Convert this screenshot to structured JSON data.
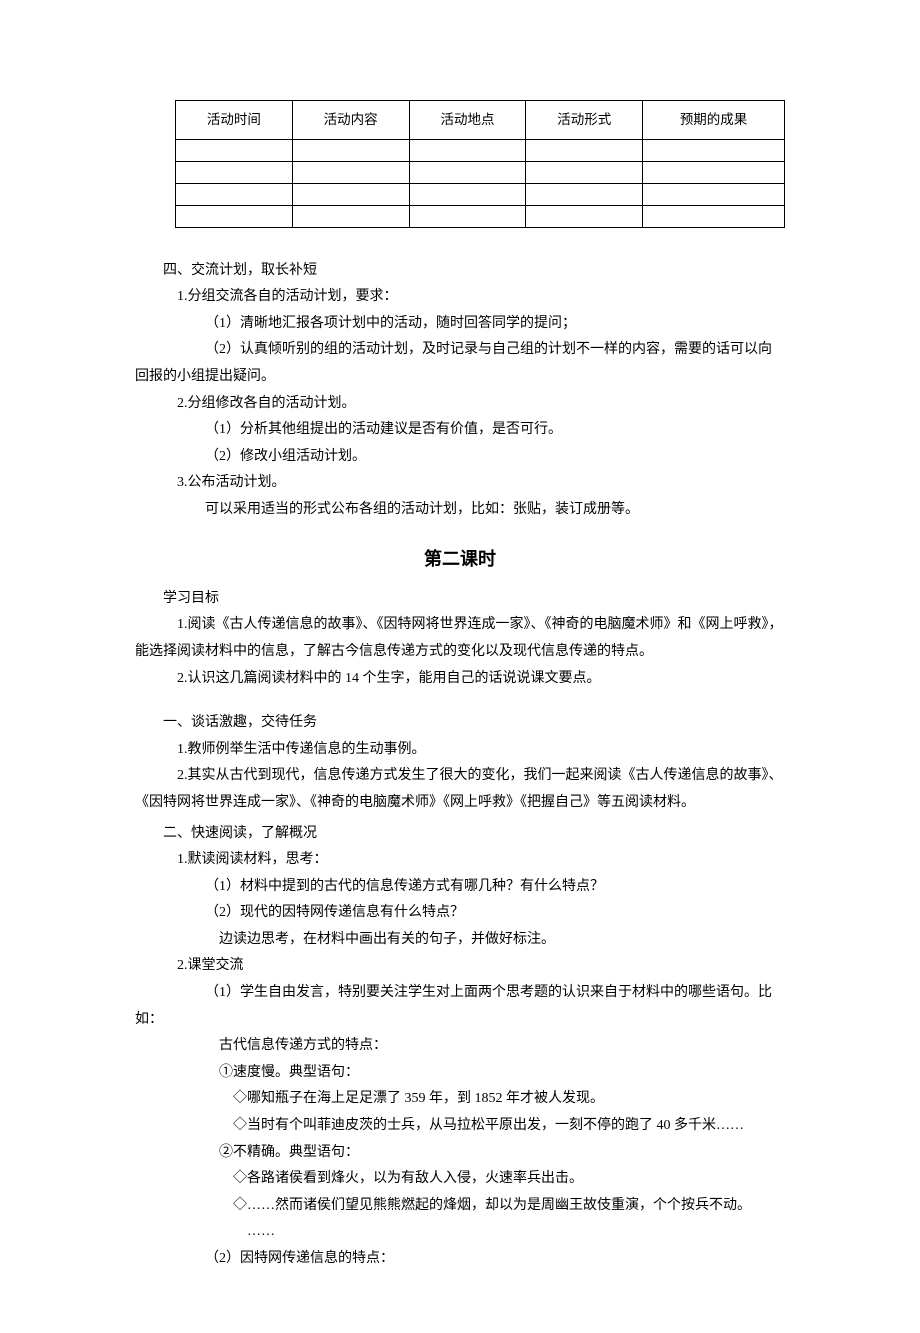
{
  "table": {
    "headers": [
      "活动时间",
      "活动内容",
      "活动地点",
      "活动形式",
      "预期的成果"
    ]
  },
  "sec4": {
    "title": "四、交流计划，取长补短",
    "p1": "1.分组交流各自的活动计划，要求：",
    "p1a": "（1）清晰地汇报各项计划中的活动，随时回答同学的提问；",
    "p1b": "（2）认真倾听别的组的活动计划，及时记录与自己组的计划不一样的内容，需要的话可以向回报的小组提出疑问。",
    "p2": "2.分组修改各自的活动计划。",
    "p2a": "（1）分析其他组提出的活动建议是否有价值，是否可行。",
    "p2b": "（2）修改小组活动计划。",
    "p3": "3.公布活动计划。",
    "p3a": "可以采用适当的形式公布各组的活动计划，比如：张贴，装订成册等。"
  },
  "lesson2": {
    "title": "第二课时",
    "goals_label": "学习目标",
    "g1": "1.阅读《古人传递信息的故事》、《因特网将世界连成一家》、《神奇的电脑魔术师》和《网上呼救》，能选择阅读材料中的信息，了解古今信息传递方式的变化以及现代信息传递的特点。",
    "g2": "2.认识这几篇阅读材料中的 14 个生字，能用自己的话说说课文要点。",
    "s1_title": "一、谈话激趣，交待任务",
    "s1_p1": "1.教师例举生活中传递信息的生动事例。",
    "s1_p2": "2.其实从古代到现代，信息传递方式发生了很大的变化，我们一起来阅读《古人传递信息的故事》、《因特网将世界连成一家》、《神奇的电脑魔术师》《网上呼救》《把握自己》等五阅读材料。",
    "s2_title": "二、快速阅读，了解概况",
    "s2_p1": "1.默读阅读材料，思考：",
    "s2_p1a": "（1）材料中提到的古代的信息传递方式有哪几种？有什么特点？",
    "s2_p1b": "（2）现代的因特网传递信息有什么特点？",
    "s2_p1c": "边读边思考，在材料中画出有关的句子，并做好标注。",
    "s2_p2": "2.课堂交流",
    "s2_p2a": "（1）学生自由发言，特别要关注学生对上面两个思考题的认识来自于材料中的哪些语句。比如：",
    "s2_p2a_sub": "古代信息传递方式的特点：",
    "s2_p2a_i": "①速度慢。典型语句：",
    "s2_p2a_i_a": "◇哪知瓶子在海上足足漂了 359 年，到 1852 年才被人发现。",
    "s2_p2a_i_b": "◇当时有个叫菲迪皮茨的士兵，从马拉松平原出发，一刻不停的跑了 40 多千米……",
    "s2_p2a_ii": "②不精确。典型语句：",
    "s2_p2a_ii_a": "◇各路诸侯看到烽火，以为有敌人入侵，火速率兵出击。",
    "s2_p2a_ii_b": "◇……然而诸侯们望见熊熊燃起的烽烟，却以为是周幽王故伎重演，个个按兵不动。",
    "s2_p2a_ellipsis": "……",
    "s2_p2b": "（2）因特网传递信息的特点："
  }
}
